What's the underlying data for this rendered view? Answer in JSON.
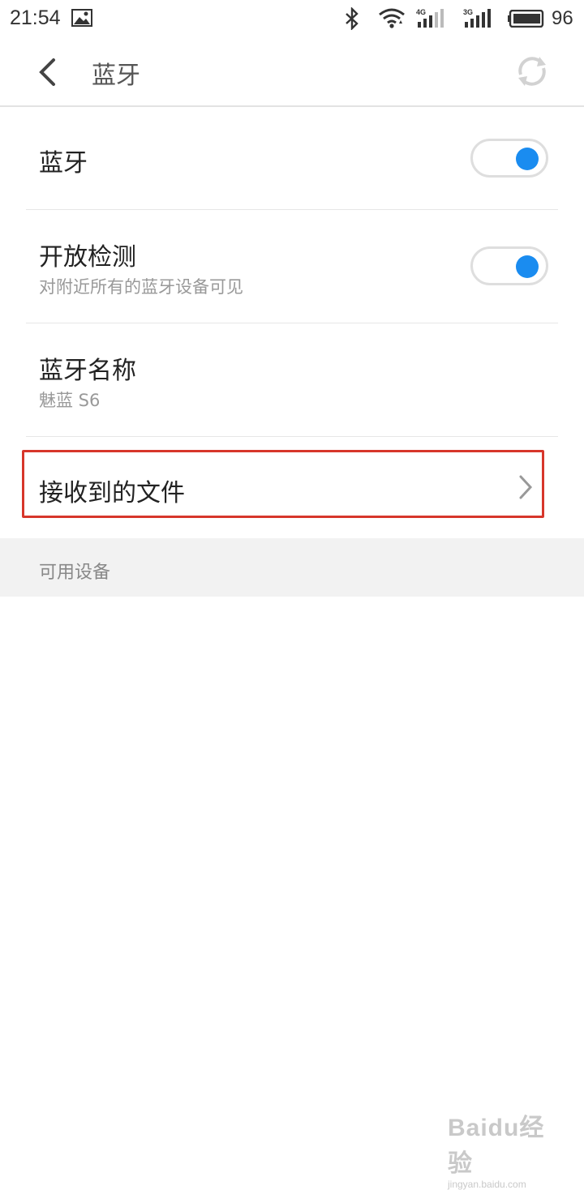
{
  "status_bar": {
    "time": "21:54",
    "battery_percent": "96",
    "signal_1_label": "4G",
    "signal_2_label": "3G"
  },
  "toolbar": {
    "title": "蓝牙"
  },
  "settings": [
    {
      "title": "蓝牙",
      "subtitle": "",
      "toggle_on": true
    },
    {
      "title": "开放检测",
      "subtitle": "对附近所有的蓝牙设备可见",
      "toggle_on": true
    },
    {
      "title": "蓝牙名称",
      "subtitle": "魅蓝 S6"
    },
    {
      "title": "接收到的文件"
    }
  ],
  "section": {
    "label": "可用设备"
  },
  "colors": {
    "accent": "#1a8cf0",
    "highlight_border": "#d7362b",
    "section_bg": "#f2f2f2"
  },
  "watermark": {
    "main": "Baidu经验",
    "url": "jingyan.baidu.com"
  }
}
